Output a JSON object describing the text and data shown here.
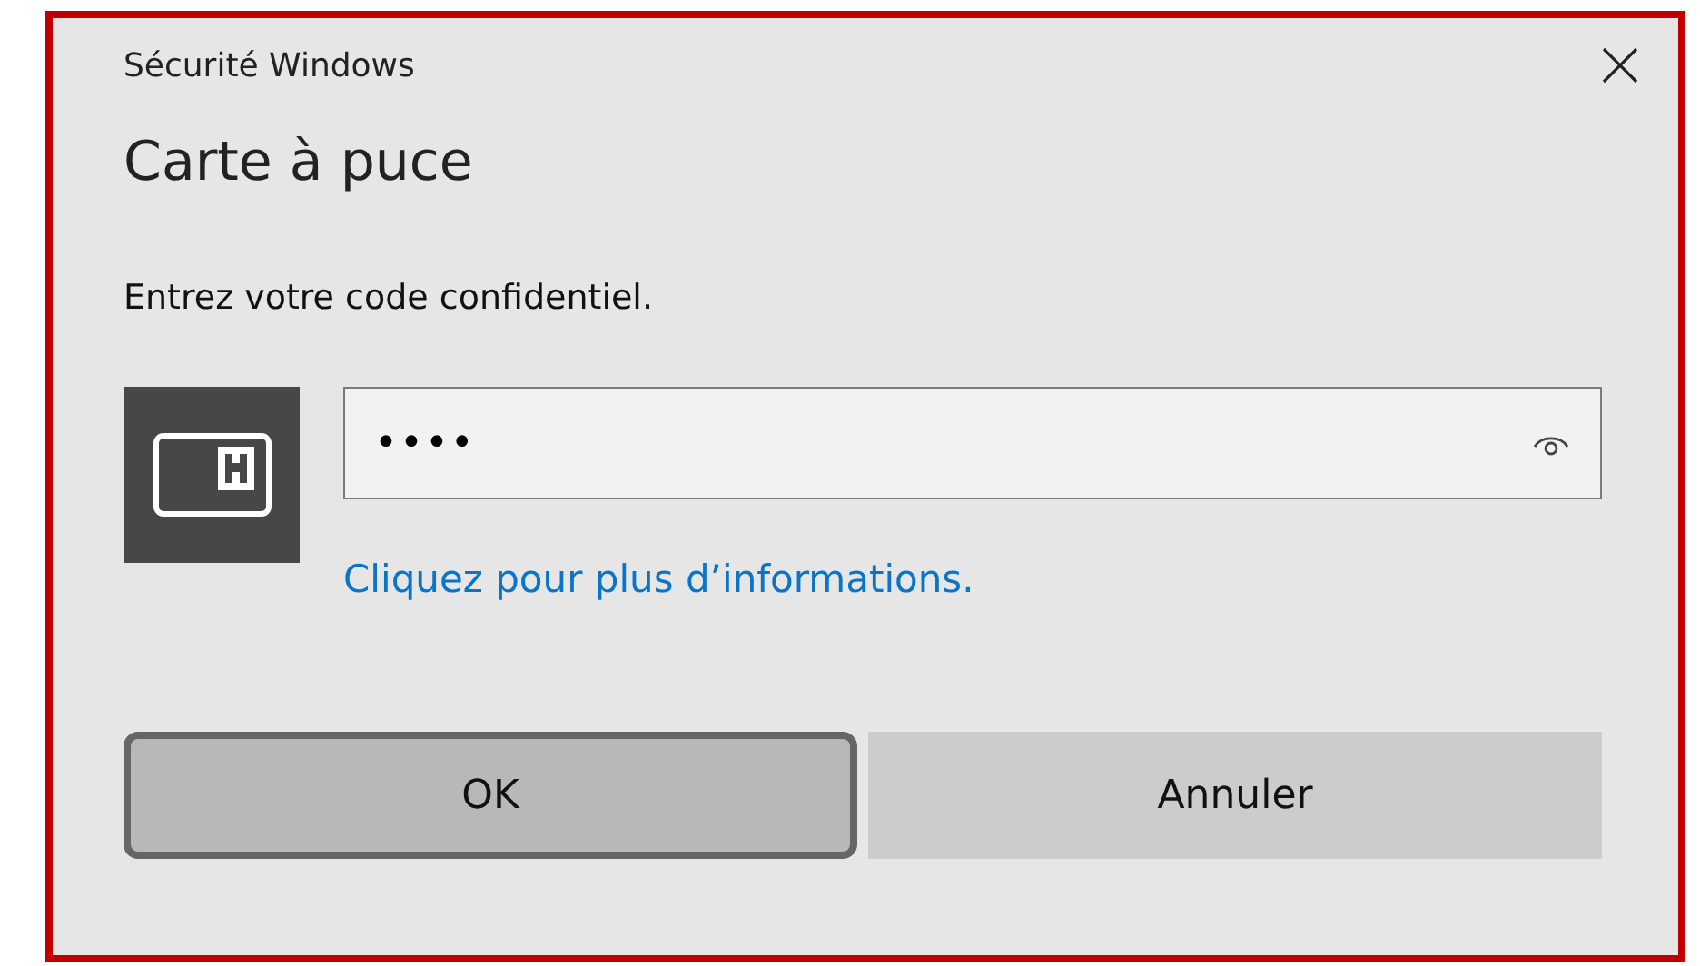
{
  "window": {
    "title": "Sécurité Windows"
  },
  "heading": "Carte à puce",
  "prompt": "Entrez votre code confidentiel.",
  "pin_field": {
    "value": "••••"
  },
  "link": "Cliquez pour plus d’informations.",
  "buttons": [
    {
      "label": "OK",
      "focused": true
    },
    {
      "label": "Annuler",
      "focused": false
    }
  ]
}
